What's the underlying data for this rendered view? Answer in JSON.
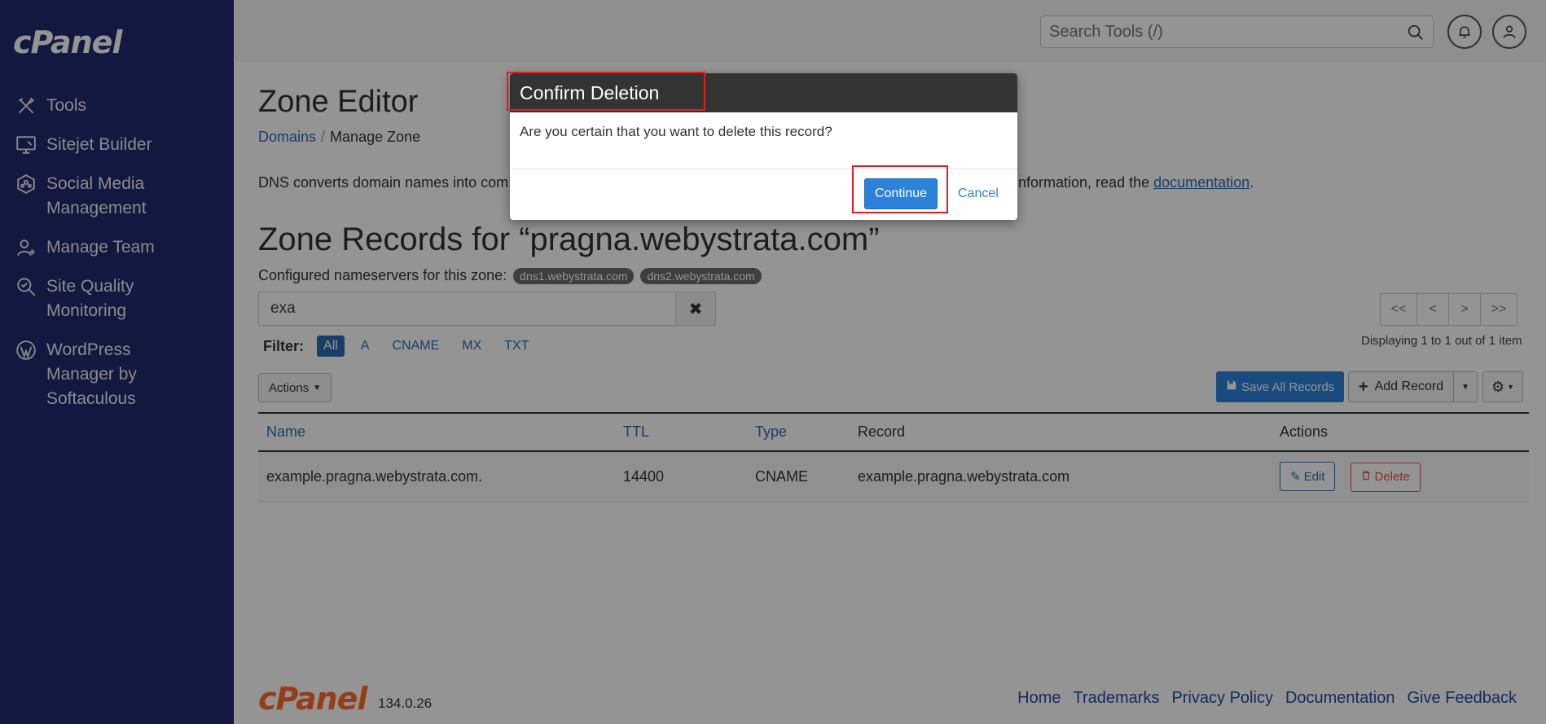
{
  "sidebar": {
    "logo": "cPanel",
    "items": [
      {
        "label": "Tools",
        "icon": "tools-icon"
      },
      {
        "label": "Sitejet Builder",
        "icon": "monitor-icon"
      },
      {
        "label": "Social Media\nManagement",
        "icon": "social-icon"
      },
      {
        "label": "Manage Team",
        "icon": "add-user-icon"
      },
      {
        "label": "Site Quality\nMonitoring",
        "icon": "site-check-icon"
      },
      {
        "label": "WordPress\n   Manager by\nSoftaculous",
        "icon": "wordpress-icon"
      }
    ]
  },
  "header": {
    "search_placeholder": "Search Tools (/)",
    "search_value": ""
  },
  "main": {
    "title": "Zone Editor",
    "breadcrumb": {
      "link": "Domains",
      "sep": "/",
      "current": "Manage Zone"
    },
    "intro_part1": "DNS converts domain names into com",
    "intro_part2": "re information, read the ",
    "intro_link": "documentation",
    "intro_end": ".",
    "zone_title": "Zone Records for “pragna.webystrata.com”",
    "ns_label": "Configured nameservers for this zone:",
    "nameservers": [
      "dns1.webystrata.com",
      "dns2.webystrata.com"
    ],
    "filter_value": "exa",
    "filter_label": "Filter:",
    "filters": [
      "All",
      "A",
      "CNAME",
      "MX",
      "TXT"
    ],
    "active_filter": "All",
    "pager": [
      "<<",
      "<",
      ">",
      ">>"
    ],
    "displaying": "Displaying 1 to 1 out of 1 item",
    "actions_label": "Actions",
    "save_all_label": "Save All Records",
    "add_record_label": "Add Record",
    "table": {
      "headers": [
        "Name",
        "TTL",
        "Type",
        "Record",
        "Actions"
      ],
      "rows": [
        {
          "name": "example.pragna.webystrata.com.",
          "ttl": "14400",
          "type": "CNAME",
          "record": "example.pragna.webystrata.com",
          "edit": "Edit",
          "delete": "Delete"
        }
      ]
    }
  },
  "footer": {
    "logo": "cPanel",
    "version": "134.0.26",
    "links": [
      "Home",
      "Trademarks",
      "Privacy Policy",
      "Documentation",
      "Give Feedback"
    ]
  },
  "dialog": {
    "title": "Confirm Deletion",
    "message": "Are you certain that you want to delete this record?",
    "continue_label": "Continue",
    "cancel_label": "Cancel"
  },
  "colors": {
    "sidebar_bg": "#1f2a6d",
    "accent": "#2b82d9",
    "link": "#2b6cb0",
    "danger": "#d9534f",
    "highlight": "#e02020"
  }
}
